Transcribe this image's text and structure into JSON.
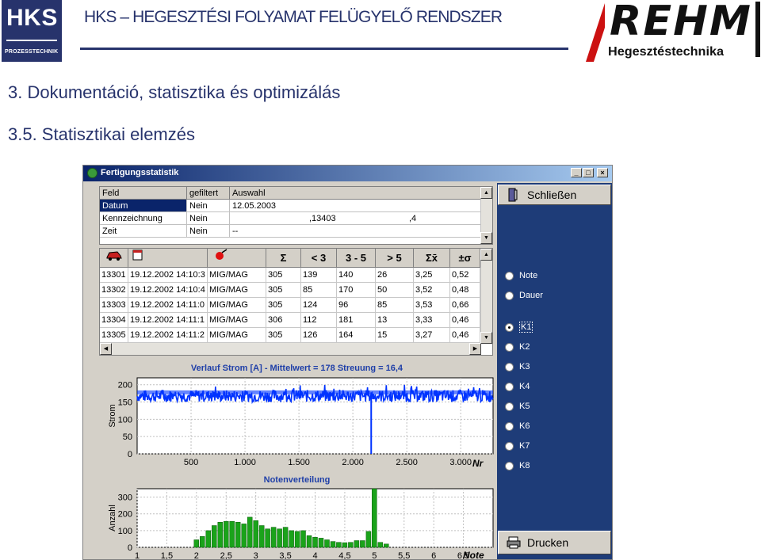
{
  "header": {
    "hks_logo_big": "HKS",
    "hks_logo_small": "PROZESSTECHNIK",
    "title": "HKS – HEGESZTÉSI FOLYAMAT FELÜGYELŐ RENDSZER",
    "rehm_logo_big": "REHM",
    "rehm_logo_small": "Hegesztéstechnika",
    "section": "3. Dokumentáció, statisztika és optimizálás",
    "subsection": "3.5. Statisztikai elemzés"
  },
  "window": {
    "title": "Fertigungsstatistik",
    "buttons": {
      "minimize": "_",
      "maximize": "□",
      "close": "×"
    }
  },
  "filter_grid": {
    "headers": [
      "Feld",
      "gefiltert",
      "Auswahl"
    ],
    "rows": [
      {
        "field": "Datum",
        "filtered": "Nein",
        "selection": "12.05.2003",
        "extra": ""
      },
      {
        "field": "Kennzeichnung",
        "filtered": "Nein",
        "selection": ",13403",
        "extra": ",4"
      },
      {
        "field": "Zeit",
        "filtered": "Nein",
        "selection": "--",
        "extra": ""
      }
    ]
  },
  "data_table": {
    "headers": [
      "Σ",
      "< 3",
      "3 - 5",
      "> 5",
      "Σx̄",
      "±σ"
    ],
    "rows": [
      [
        "13301",
        "19.12.2002 14:10:3",
        "MIG/MAG",
        "305",
        "139",
        "140",
        "26",
        "3,25",
        "0,52"
      ],
      [
        "13302",
        "19.12.2002 14:10:4",
        "MIG/MAG",
        "305",
        "85",
        "170",
        "50",
        "3,52",
        "0,48"
      ],
      [
        "13303",
        "19.12.2002 14:11:0",
        "MIG/MAG",
        "305",
        "124",
        "96",
        "85",
        "3,53",
        "0,66"
      ],
      [
        "13304",
        "19.12.2002 14:11:1",
        "MIG/MAG",
        "306",
        "112",
        "181",
        "13",
        "3,33",
        "0,46"
      ],
      [
        "13305",
        "19.12.2002 14:11:2",
        "MIG/MAG",
        "305",
        "126",
        "164",
        "15",
        "3,27",
        "0,46"
      ]
    ]
  },
  "right_panel": {
    "close_label": "Schließen",
    "print_label": "Drucken",
    "radios": [
      "Note",
      "Dauer",
      "K1",
      "K2",
      "K3",
      "K4",
      "K5",
      "K6",
      "K7",
      "K8"
    ],
    "selected": "K1"
  },
  "colors": {
    "accent": "#27336c",
    "series_current": "#0033ff",
    "series_histogram": "#1aa31a",
    "panel": "#1e3c78"
  },
  "chart_data": [
    {
      "type": "line",
      "title": "Verlauf Strom [A] - Mittelwert = 178  Streuung = 16,4",
      "xlabel": "Nr",
      "ylabel": "Strom",
      "xlim": [
        0,
        3300
      ],
      "ylim": [
        0,
        220
      ],
      "xticks": [
        500,
        1000,
        1500,
        2000,
        2500,
        3000
      ],
      "xtick_labels": [
        "500",
        "1.000",
        "1.500",
        "2.000",
        "2.500",
        "3.000"
      ],
      "yticks": [
        0,
        50,
        100,
        150,
        200
      ],
      "mean": 178,
      "band": [
        150,
        185
      ],
      "dips": [
        {
          "x": 2170,
          "y": 0
        }
      ],
      "grid": true
    },
    {
      "type": "bar",
      "title": "Notenverteilung",
      "xlabel": "Note",
      "ylabel": "Anzahl",
      "xlim": [
        1,
        7
      ],
      "ylim": [
        0,
        350
      ],
      "xticks": [
        1,
        1.5,
        2,
        2.5,
        3,
        3.5,
        4,
        4.5,
        5,
        5.5,
        6,
        6.5
      ],
      "xtick_labels": [
        "1",
        "1,5",
        "2",
        "2,5",
        "3",
        "3,5",
        "4",
        "4,5",
        "5",
        "5,5",
        "6",
        "6,5"
      ],
      "yticks": [
        0,
        100,
        200,
        300
      ],
      "x": [
        2.0,
        2.1,
        2.2,
        2.3,
        2.4,
        2.5,
        2.6,
        2.7,
        2.8,
        2.9,
        3.0,
        3.1,
        3.2,
        3.3,
        3.4,
        3.5,
        3.6,
        3.7,
        3.8,
        3.9,
        4.0,
        4.1,
        4.2,
        4.3,
        4.4,
        4.5,
        4.6,
        4.7,
        4.8,
        4.9,
        5.0,
        5.1,
        5.2
      ],
      "values": [
        45,
        65,
        100,
        130,
        150,
        155,
        155,
        150,
        140,
        180,
        160,
        130,
        110,
        120,
        110,
        120,
        100,
        95,
        100,
        70,
        60,
        55,
        45,
        35,
        30,
        28,
        30,
        40,
        40,
        95,
        355,
        30,
        20
      ],
      "grid": true
    }
  ]
}
